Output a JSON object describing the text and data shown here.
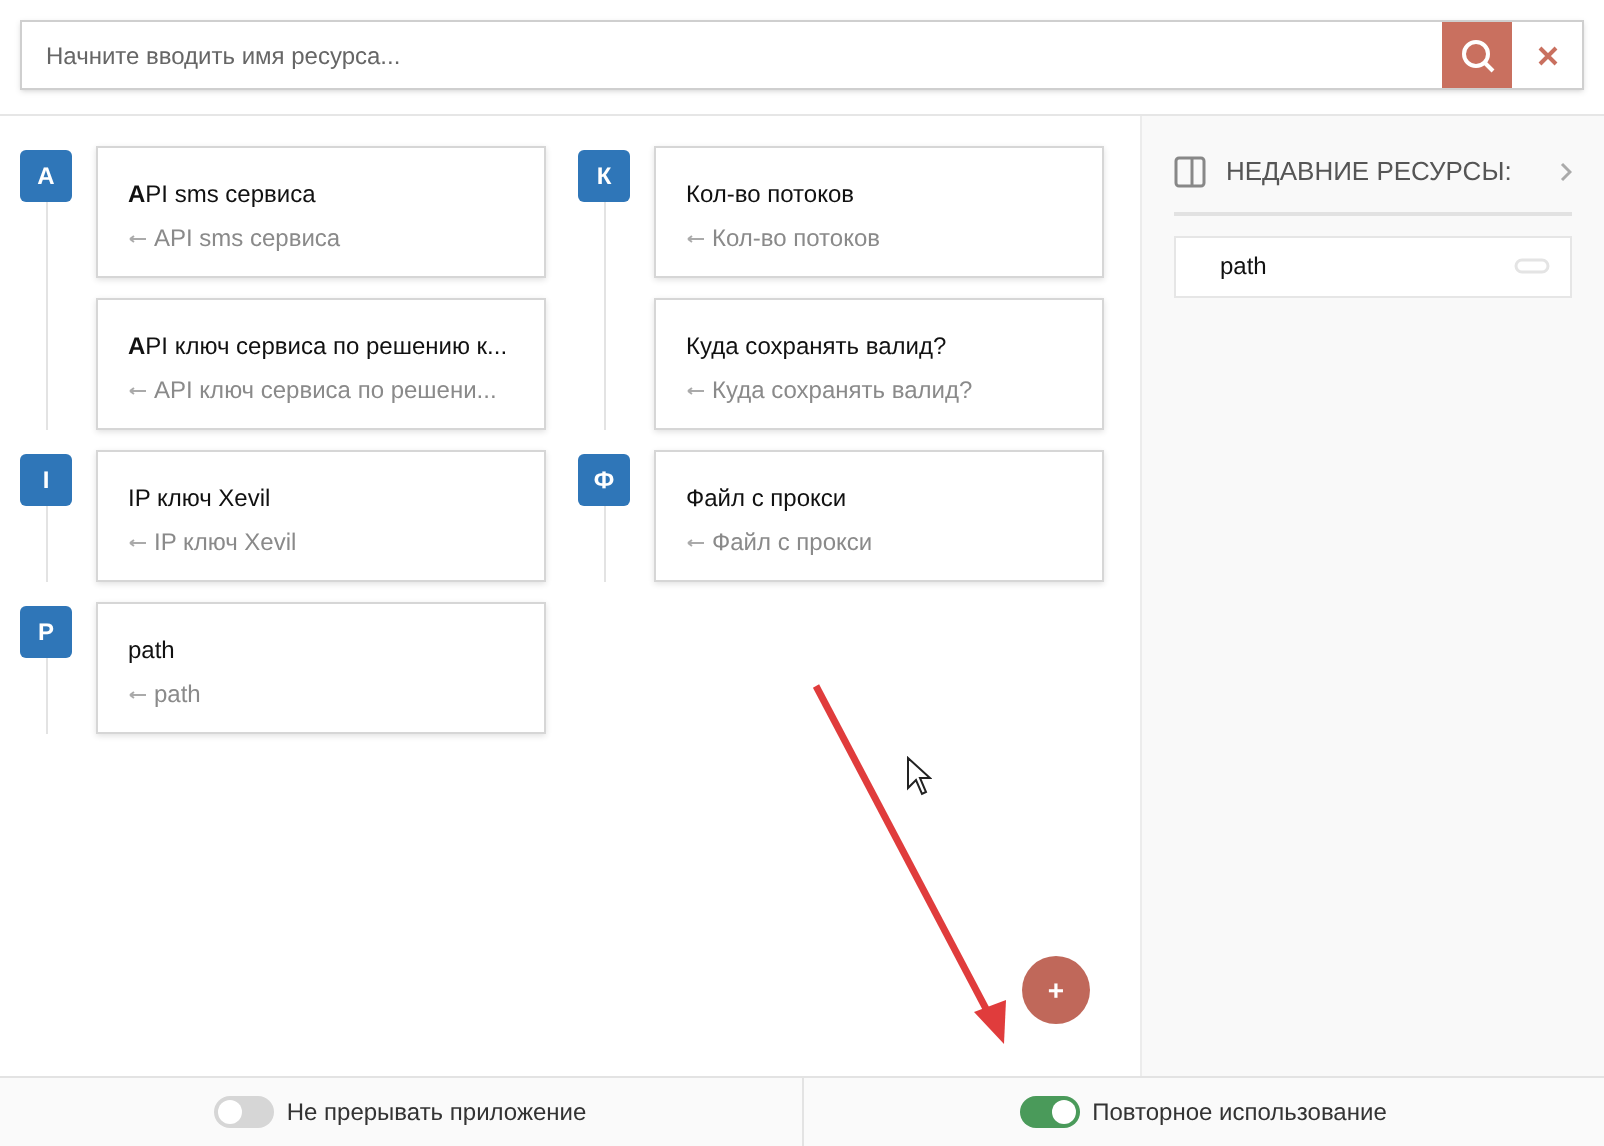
{
  "search": {
    "placeholder": "Начните вводить имя ресурса..."
  },
  "columns": [
    {
      "groups": [
        {
          "letter": "A",
          "items": [
            {
              "title": "**A**PI sms сервиса",
              "subtitle": "API sms сервиса"
            },
            {
              "title": "**A**PI ключ сервиса по решению к...",
              "subtitle": "API ключ сервиса по решени..."
            }
          ]
        },
        {
          "letter": "I",
          "items": [
            {
              "title": "IP ключ Xevil",
              "subtitle": "IP ключ Xevil"
            }
          ]
        },
        {
          "letter": "P",
          "items": [
            {
              "title": "path",
              "subtitle": "path"
            }
          ]
        }
      ]
    },
    {
      "groups": [
        {
          "letter": "К",
          "items": [
            {
              "title": "Кол-во потоков",
              "subtitle": "Кол-во потоков"
            },
            {
              "title": "Куда сохранять валид?",
              "subtitle": "Куда сохранять валид?"
            }
          ]
        },
        {
          "letter": "Ф",
          "items": [
            {
              "title": "Файл с прокси",
              "subtitle": "Файл с прокси"
            }
          ]
        }
      ]
    }
  ],
  "add_button": "+",
  "sidebar": {
    "title": "НЕДАВНИЕ РЕСУРСЫ:",
    "items": [
      {
        "label": "path"
      }
    ]
  },
  "footer": [
    {
      "label": "Не прерывать приложение",
      "on": false
    },
    {
      "label": "Повторное использование",
      "on": true
    }
  ]
}
